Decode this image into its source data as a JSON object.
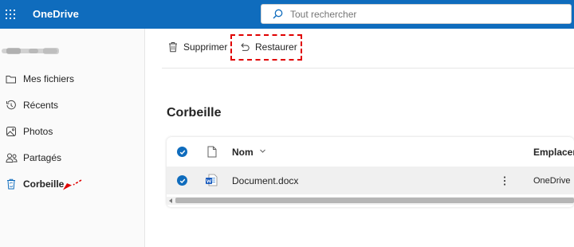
{
  "header": {
    "app_title": "OneDrive",
    "search_placeholder": "Tout rechercher"
  },
  "sidebar": {
    "items": [
      {
        "label": "Mes fichiers",
        "icon": "folder-icon"
      },
      {
        "label": "Récents",
        "icon": "history-icon"
      },
      {
        "label": "Photos",
        "icon": "photo-icon"
      },
      {
        "label": "Partagés",
        "icon": "people-icon"
      },
      {
        "label": "Corbeille",
        "icon": "recycle-bin-icon",
        "active": true
      }
    ]
  },
  "toolbar": {
    "delete_label": "Supprimer",
    "restore_label": "Restaurer"
  },
  "page": {
    "title": "Corbeille"
  },
  "table": {
    "columns": {
      "name": "Nom",
      "location": "Emplacem"
    },
    "rows": [
      {
        "name": "Document.docx",
        "location": "OneDrive",
        "selected": true
      }
    ]
  },
  "colors": {
    "brand": "#0f6cbd",
    "annotation": "#e00000"
  }
}
